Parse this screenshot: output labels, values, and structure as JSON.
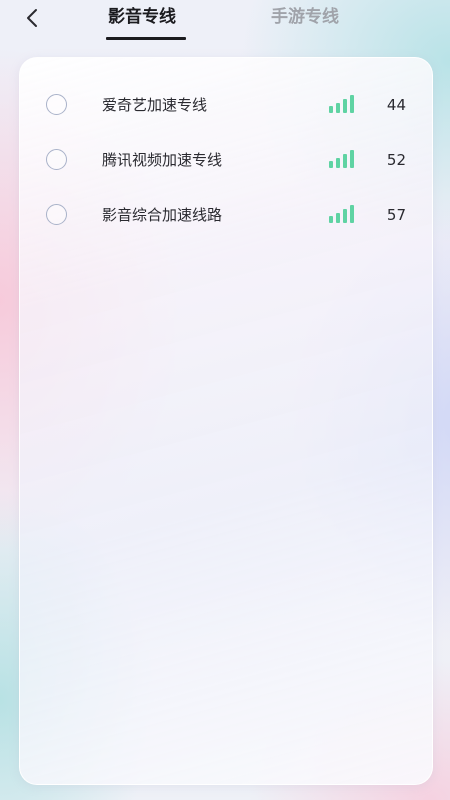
{
  "header": {
    "back_icon": "chevron-left-icon",
    "tabs": [
      {
        "label": "影音专线",
        "active": true
      },
      {
        "label": "手游专线",
        "active": false
      }
    ]
  },
  "lines": [
    {
      "name": "爱奇艺加速专线",
      "ping": "44",
      "signal_level": 4,
      "selected": false
    },
    {
      "name": "腾讯视频加速专线",
      "ping": "52",
      "signal_level": 4,
      "selected": false
    },
    {
      "name": "影音综合加速线路",
      "ping": "57",
      "signal_level": 4,
      "selected": false
    }
  ],
  "colors": {
    "signal": "#5fd3a3",
    "text": "#2a2a30",
    "tab_active": "#1b1b1f",
    "tab_inactive": "#a0a3aa",
    "radio_border": "#a9b2c9"
  }
}
